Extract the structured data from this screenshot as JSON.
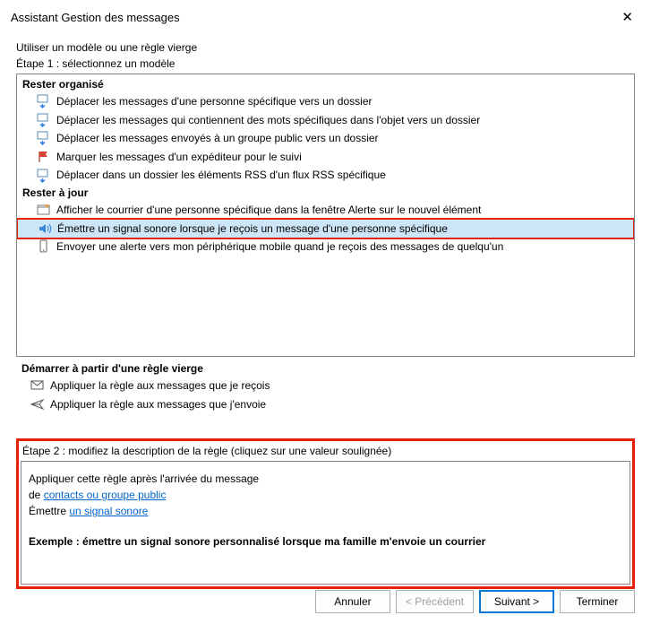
{
  "title": "Assistant Gestion des messages",
  "intro_line1": "Utiliser un modèle ou une règle vierge",
  "intro_line2": "Étape 1 : sélectionnez un modèle",
  "groups": {
    "organized": {
      "header": "Rester organisé",
      "items": [
        "Déplacer les messages d'une personne spécifique vers un dossier",
        "Déplacer les messages qui contiennent des mots spécifiques dans l'objet vers un dossier",
        "Déplacer les messages envoyés à un groupe public vers un dossier",
        "Marquer les messages d'un expéditeur pour le suivi",
        "Déplacer dans un dossier les éléments RSS d'un flux RSS spécifique"
      ]
    },
    "uptodate": {
      "header": "Rester à jour",
      "items": [
        "Afficher le courrier d'une personne spécifique dans la fenêtre Alerte sur le nouvel élément",
        "Émettre un signal sonore lorsque je reçois un message d'une personne spécifique",
        "Envoyer une alerte vers mon périphérique mobile quand je reçois des messages de quelqu'un"
      ]
    },
    "blank": {
      "header": "Démarrer à partir d'une règle vierge",
      "items": [
        "Appliquer la règle aux messages que je reçois",
        "Appliquer la règle aux messages que j'envoie"
      ]
    }
  },
  "step2_label": "Étape 2 : modifiez la description de la règle (cliquez sur une valeur soulignée)",
  "description": {
    "line1": "Appliquer cette règle après l'arrivée du message",
    "line2_prefix": "de ",
    "line2_link": "contacts ou groupe public",
    "line3_prefix": "Émettre ",
    "line3_link": "un signal sonore",
    "example": "Exemple : émettre un signal sonore personnalisé lorsque ma famille m'envoie un courrier"
  },
  "buttons": {
    "cancel": "Annuler",
    "prev": "<  Précédent",
    "next": "Suivant  >",
    "finish": "Terminer"
  }
}
